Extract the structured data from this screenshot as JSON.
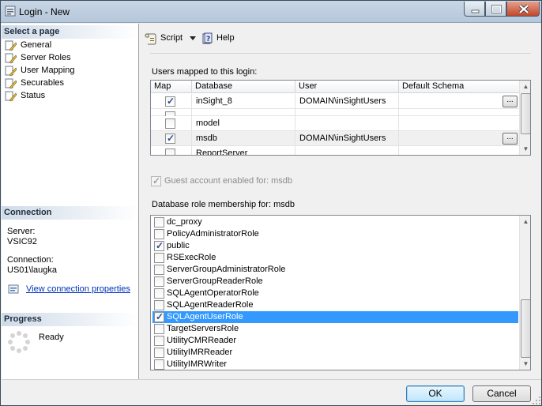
{
  "window": {
    "title": "Login - New"
  },
  "left": {
    "select_page_heading": "Select a page",
    "pages": [
      {
        "label": "General"
      },
      {
        "label": "Server Roles"
      },
      {
        "label": "User Mapping"
      },
      {
        "label": "Securables"
      },
      {
        "label": "Status"
      }
    ],
    "connection_heading": "Connection",
    "server_label": "Server:",
    "server_value": "VSIC92",
    "connection_label": "Connection:",
    "connection_value": "US01\\laugka",
    "view_props_link": "View connection properties",
    "progress_heading": "Progress",
    "progress_status": "Ready"
  },
  "toolbar": {
    "script_label": "Script",
    "help_label": "Help"
  },
  "mapping": {
    "label": "Users mapped to this login:",
    "columns": [
      "Map",
      "Database",
      "User",
      "Default Schema"
    ],
    "rows": [
      {
        "checked": true,
        "database": "inSight_8",
        "user": "DOMAIN\\inSightUsers",
        "schema": "",
        "has_button": true
      },
      {
        "checked": false,
        "database": "",
        "user": "",
        "schema": "",
        "has_button": false
      },
      {
        "checked": false,
        "database": "model",
        "user": "",
        "schema": "",
        "has_button": false
      },
      {
        "checked": true,
        "database": "msdb",
        "user": "DOMAIN\\inSightUsers",
        "schema": "",
        "has_button": true
      },
      {
        "checked": false,
        "database": "ReportServer",
        "user": "",
        "schema": "",
        "has_button": false
      }
    ],
    "ellipsis": "..."
  },
  "guest": {
    "label": "Guest account enabled for: msdb",
    "checked": true
  },
  "roles": {
    "label": "Database role membership for: msdb",
    "items": [
      {
        "name": "dc_proxy",
        "checked": false
      },
      {
        "name": "PolicyAdministratorRole",
        "checked": false
      },
      {
        "name": "public",
        "checked": true
      },
      {
        "name": "RSExecRole",
        "checked": false
      },
      {
        "name": "ServerGroupAdministratorRole",
        "checked": false
      },
      {
        "name": "ServerGroupReaderRole",
        "checked": false
      },
      {
        "name": "SQLAgentOperatorRole",
        "checked": false
      },
      {
        "name": "SQLAgentReaderRole",
        "checked": false
      },
      {
        "name": "SQLAgentUserRole",
        "checked": true,
        "selected": true
      },
      {
        "name": "TargetServersRole",
        "checked": false
      },
      {
        "name": "UtilityCMRReader",
        "checked": false
      },
      {
        "name": "UtilityIMRReader",
        "checked": false
      },
      {
        "name": "UtilityIMRWriter",
        "checked": false
      }
    ]
  },
  "buttons": {
    "ok": "OK",
    "cancel": "Cancel"
  },
  "colors": {
    "selection": "#3399ff",
    "link": "#0033bb",
    "section_header": "#cfdbe8"
  }
}
